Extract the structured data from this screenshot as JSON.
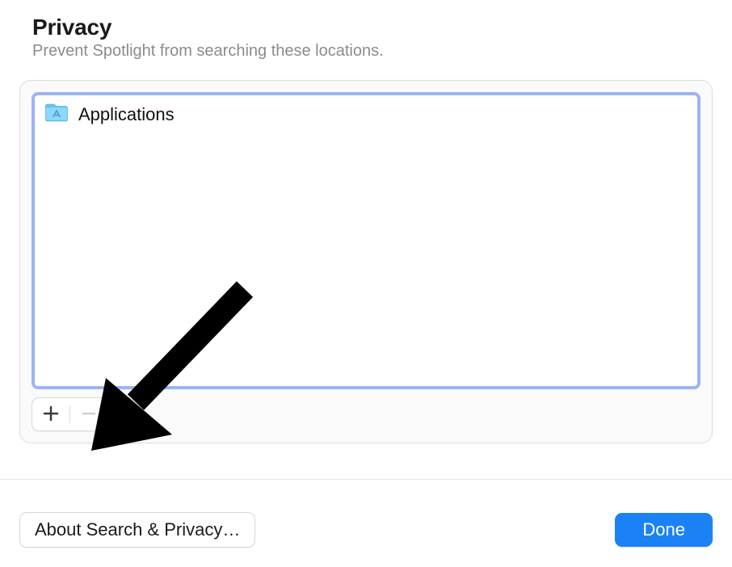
{
  "header": {
    "title": "Privacy",
    "subtitle": "Prevent Spotlight from searching these locations."
  },
  "list": {
    "items": [
      {
        "label": "Applications",
        "icon": "applications-folder-icon"
      }
    ]
  },
  "controls": {
    "add_tooltip": "Add",
    "remove_tooltip": "Remove"
  },
  "footer": {
    "about_label": "About Search & Privacy…",
    "done_label": "Done"
  },
  "colors": {
    "selection_border": "#9bb4f5",
    "primary": "#1b82f5",
    "subtitle_gray": "#8b8b8b",
    "divider": "#e5e5e5"
  }
}
